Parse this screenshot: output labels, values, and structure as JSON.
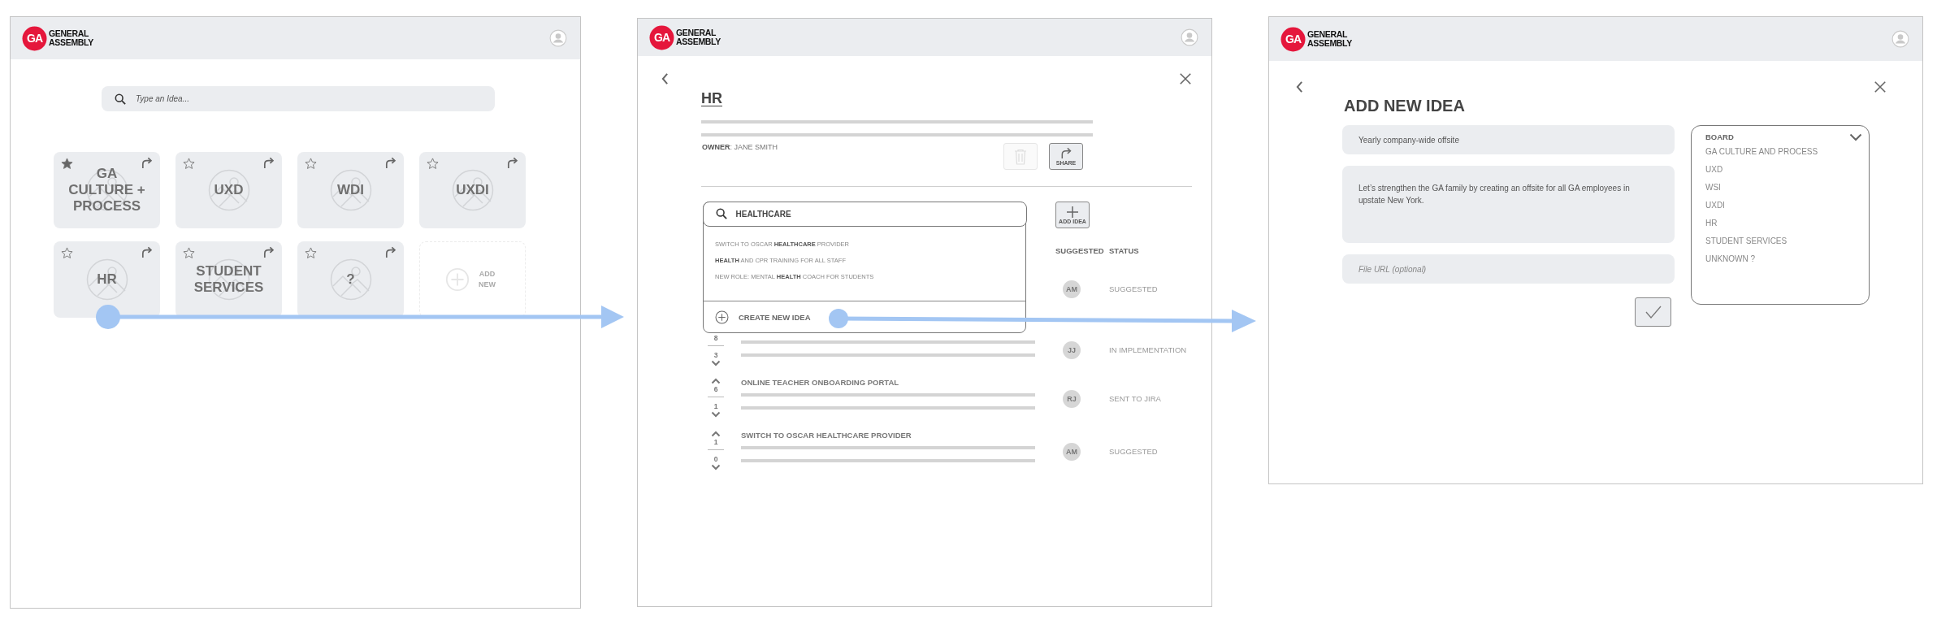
{
  "home": {
    "logo": {
      "badge": "GA",
      "wordmark": [
        "GENERAL",
        "ASSEMBLY"
      ]
    },
    "search": {
      "placeholder": "Type an Idea..."
    },
    "cards": [
      {
        "kind": "board",
        "label": "GA CULTURE + PROCESS",
        "starred": true
      },
      {
        "kind": "board",
        "label": "UXD",
        "starred": false
      },
      {
        "kind": "board",
        "label": "WDI",
        "starred": false
      },
      {
        "kind": "board",
        "label": "UXDI",
        "starred": false
      },
      {
        "kind": "board",
        "label": "HR",
        "starred": false
      },
      {
        "kind": "board",
        "label": "STUDENT SERVICES",
        "starred": false
      },
      {
        "kind": "board",
        "label": "?",
        "starred": false
      },
      {
        "kind": "add",
        "label": "ADD NEW"
      }
    ]
  },
  "board": {
    "logo": {
      "badge": "GA",
      "wordmark": [
        "GENERAL",
        "ASSEMBLY"
      ]
    },
    "title": "HR",
    "owner": "**OWNER**: JANE SMITH",
    "delete_button": {
      "disabled": true
    },
    "share_label": "SHARE",
    "search": {
      "value": "HEALTHCARE"
    },
    "suggestions": [
      "SWITCH TO OSCAR **HEALTHCARE** PROVIDER",
      "**HEALTH** AND CPR TRAINING FOR ALL STAFF",
      "NEW ROLE: MENTAL **HEALTH** COACH FOR STUDENTS"
    ],
    "create_label": "CREATE NEW IDEA",
    "add_idea_label": "ADD IDEA",
    "columns": [
      "SUGGESTED",
      "STATUS"
    ],
    "ideas": [
      {
        "kind": "covered",
        "initials": "AM",
        "status": "SUGGESTED"
      },
      {
        "kind": "partial",
        "up_votes": "8",
        "down_votes": "3",
        "initials": "JJ",
        "status": "IN IMPLEMENTATION"
      },
      {
        "kind": "full",
        "title": "ONLINE TEACHER ONBOARDING PORTAL",
        "up_votes": "6",
        "down_votes": "1",
        "initials": "RJ",
        "status": "SENT TO JIRA"
      },
      {
        "kind": "full",
        "title": "SWITCH TO OSCAR HEALTHCARE PROVIDER",
        "up_votes": "1",
        "down_votes": "0",
        "initials": "AM",
        "status": "SUGGESTED"
      }
    ]
  },
  "add_idea": {
    "logo": {
      "badge": "GA",
      "wordmark": [
        "GENERAL",
        "ASSEMBLY"
      ]
    },
    "title": "ADD NEW IDEA",
    "name_field": {
      "value": "Yearly company-wide offsite"
    },
    "description_field": {
      "value": "Let’s strengthen the GA family by creating an offsite for all GA employees in upstate New York."
    },
    "file_field": {
      "placeholder": "File URL (optional)"
    },
    "board_picker": {
      "label": "BOARD",
      "options": [
        "GA CULTURE AND PROCESS",
        "UXD",
        "WSI",
        "UXDI",
        "HR",
        "STUDENT SERVICES",
        "UNKNOWN ?"
      ]
    }
  }
}
